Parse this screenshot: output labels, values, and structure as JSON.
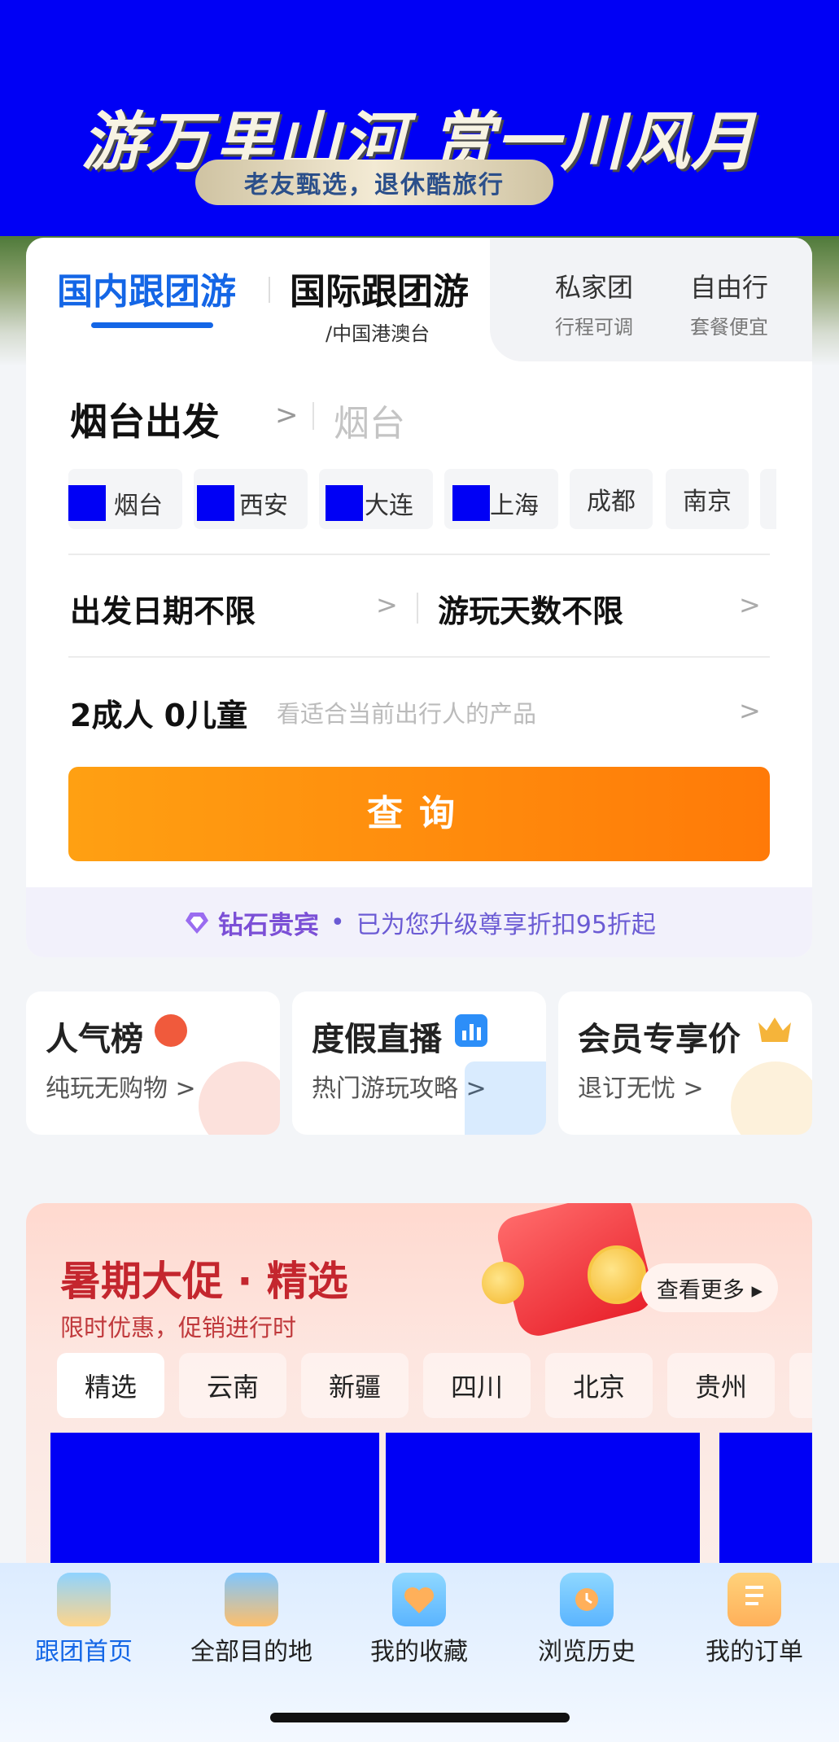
{
  "banner": {
    "title": "游万里山河 赏一川风月",
    "subtitle": "老友甄选，退休酷旅行"
  },
  "search": {
    "tabs": {
      "domestic": "国内跟团游",
      "international": "国际跟团游",
      "international_sub": "/中国港澳台",
      "private": "私家团",
      "private_sub": "行程可调",
      "free": "自由行",
      "free_sub": "套餐便宜"
    },
    "from_label": "烟台出发",
    "chevron": ">",
    "destination_placeholder": "烟台",
    "cities": [
      "烟台",
      "西安",
      "大连",
      "上海",
      "成都",
      "南京"
    ],
    "date_label": "出发日期不限",
    "days_label": "游玩天数不限",
    "travelers": "2成人 0儿童",
    "travelers_hint": "看适合当前出行人的产品",
    "query_button": "查询",
    "vip_level": "钻石贵宾",
    "vip_dot": "•",
    "vip_text": "已为您升级尊享折扣95折起"
  },
  "features": [
    {
      "title": "人气榜",
      "subtitle": "纯玩无购物 >",
      "icon": "medal-icon",
      "color": "#f05a3c"
    },
    {
      "title": "度假直播",
      "subtitle": "热门游玩攻略 >",
      "icon": "bar-chart-icon",
      "color": "#2c8ef8"
    },
    {
      "title": "会员专享价",
      "subtitle": "退订无忧 >",
      "icon": "crown-icon",
      "color": "#f5b43a"
    }
  ],
  "promo": {
    "title": "暑期大促 · 精选",
    "subtitle": "限时优惠，促销进行时",
    "more": "查看更多 ▸",
    "tabs": [
      "精选",
      "云南",
      "新疆",
      "四川",
      "北京",
      "贵州"
    ]
  },
  "bottom_nav": [
    {
      "label": "跟团首页",
      "icon": "palm-island-icon",
      "active": true
    },
    {
      "label": "全部目的地",
      "icon": "beach-umbrella-icon",
      "active": false
    },
    {
      "label": "我的收藏",
      "icon": "heart-icon",
      "active": false
    },
    {
      "label": "浏览历史",
      "icon": "clock-icon",
      "active": false
    },
    {
      "label": "我的订单",
      "icon": "order-list-icon",
      "active": false
    }
  ],
  "colors": {
    "brand_blue": "#1466e6",
    "query_orange": "#ff8a0c",
    "vip_purple": "#7b4fd6",
    "promo_red": "#c4262e"
  }
}
